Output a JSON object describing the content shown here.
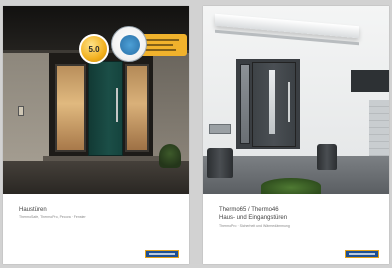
{
  "covers": [
    {
      "title_lines": [
        "Haustüren"
      ],
      "subtitle": "ThermoSafe, ThermoPro, Pecora · Fenster"
    },
    {
      "title_lines": [
        "Thermo65 / Thermo46",
        "Haus- und Eingangstüren"
      ],
      "subtitle": "ThermoPro · Sicherheit und Wärmedämmung"
    }
  ],
  "badge_text": "5.0",
  "colors": {
    "page_background": "#d2d2d2",
    "brand_blue": "#1d4f93",
    "brand_accent": "#e3a21a",
    "badge_yellow": "#f2b01e",
    "door_green": "#1b4e47",
    "door_anthracite": "#4a4f54"
  }
}
